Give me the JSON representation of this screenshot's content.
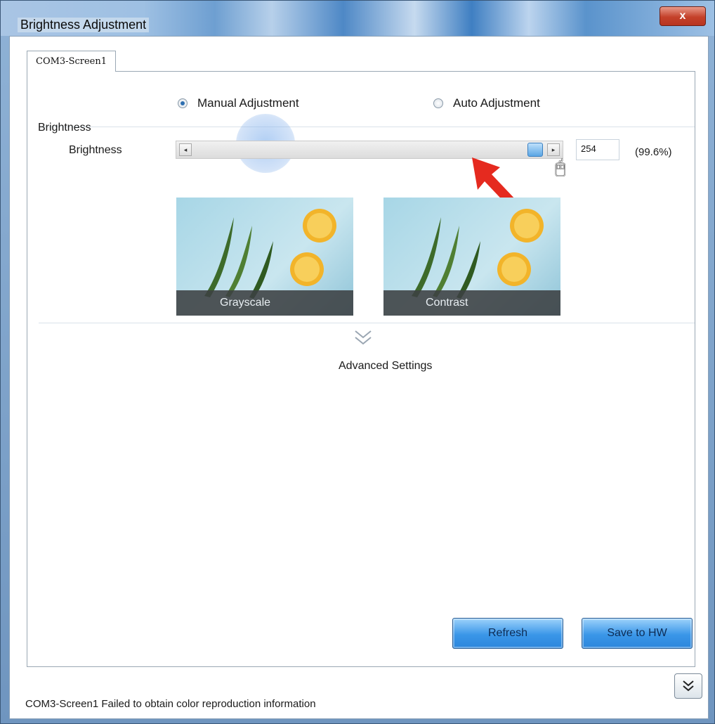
{
  "window": {
    "title": "Brightness Adjustment",
    "close_label": "x"
  },
  "tabs": [
    {
      "label": "COM3-Screen1",
      "selected": true
    }
  ],
  "mode": {
    "manual_label": "Manual Adjustment",
    "auto_label": "Auto Adjustment",
    "selected": "manual"
  },
  "brightness": {
    "group_label": "Brightness",
    "label": "Brightness",
    "value": "254",
    "percent": "(99.6%)",
    "max": 255,
    "level_fraction": 0.996
  },
  "cards": [
    {
      "label": "Grayscale"
    },
    {
      "label": "Contrast"
    }
  ],
  "advanced": {
    "label": "Advanced Settings"
  },
  "buttons": {
    "refresh": "Refresh",
    "save": "Save to HW"
  },
  "status": {
    "message": "COM3-Screen1 Failed to obtain color reproduction information"
  },
  "colors": {
    "accent": "#3a96e8",
    "annotation_arrow": "#e52a1f"
  }
}
